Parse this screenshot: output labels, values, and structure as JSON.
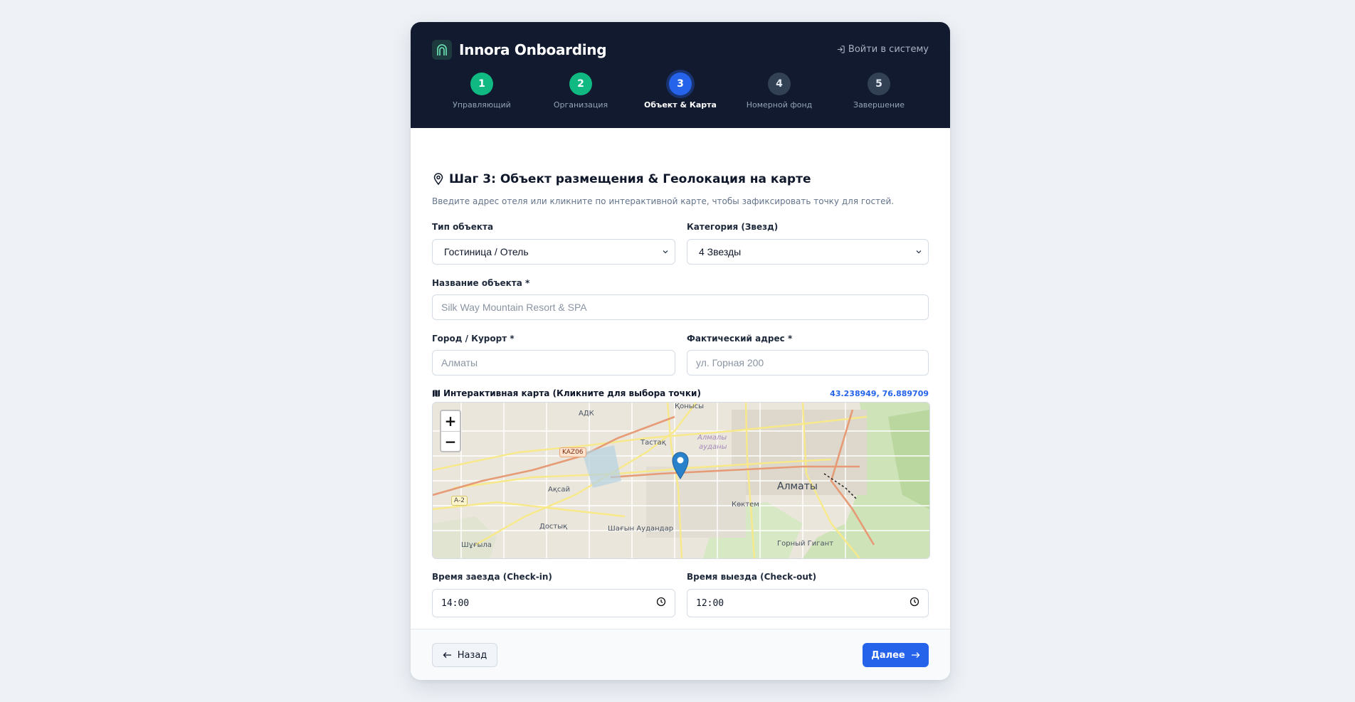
{
  "header": {
    "brand": "Innora Onboarding",
    "login": "Войти в систему"
  },
  "steps": [
    {
      "number": "1",
      "label": "Управляющий",
      "state": "done"
    },
    {
      "number": "2",
      "label": "Организация",
      "state": "done"
    },
    {
      "number": "3",
      "label": "Объект & Карта",
      "state": "active"
    },
    {
      "number": "4",
      "label": "Номерной фонд",
      "state": "todo"
    },
    {
      "number": "5",
      "label": "Завершение",
      "state": "todo"
    }
  ],
  "form": {
    "title": "Шаг 3: Объект размещения & Геолокация на карте",
    "subtitle": "Введите адрес отеля или кликните по интерактивной карте, чтобы зафиксировать точку для гостей.",
    "type_label": "Тип объекта",
    "type_value": "Гостиница / Отель",
    "category_label": "Категория (Звезд)",
    "category_value": "4 Звезды",
    "name_label": "Название объекта *",
    "name_placeholder": "Silk Way Mountain Resort & SPA",
    "city_label": "Город / Курорт *",
    "city_placeholder": "Алматы",
    "address_label": "Фактический адрес *",
    "address_placeholder": "ул. Горная 200",
    "checkin_label": "Время заезда (Check-in)",
    "checkin_value": "14:00",
    "checkout_label": "Время выезда (Check-out)",
    "checkout_value": "12:00"
  },
  "map": {
    "label": "Интерактивная карта (Кликните для выбора точки)",
    "coords": "43.238949, 76.889709",
    "zoom_in": "+",
    "zoom_out": "−",
    "places": {
      "adk": "АДК",
      "konysy": "Қонысы",
      "almaly1": "Алмалы",
      "almaly2": "ауданы",
      "tastak": "Тастақ",
      "aksai": "Ақсай",
      "almaty": "Алматы",
      "koktem": "Көктем",
      "dostyk": "Достық",
      "shagyn": "Шағын Аудандар",
      "shugyla": "Шұғыла",
      "gigant": "Горный Гигант"
    },
    "roads": {
      "kaz06": "KAZ06",
      "a2": "A-2"
    }
  },
  "footer": {
    "back": "Назад",
    "next": "Далее"
  },
  "colors": {
    "header_bg": "#111a2e",
    "accent": "#2563eb",
    "done": "#10b981",
    "todo": "#334155"
  }
}
